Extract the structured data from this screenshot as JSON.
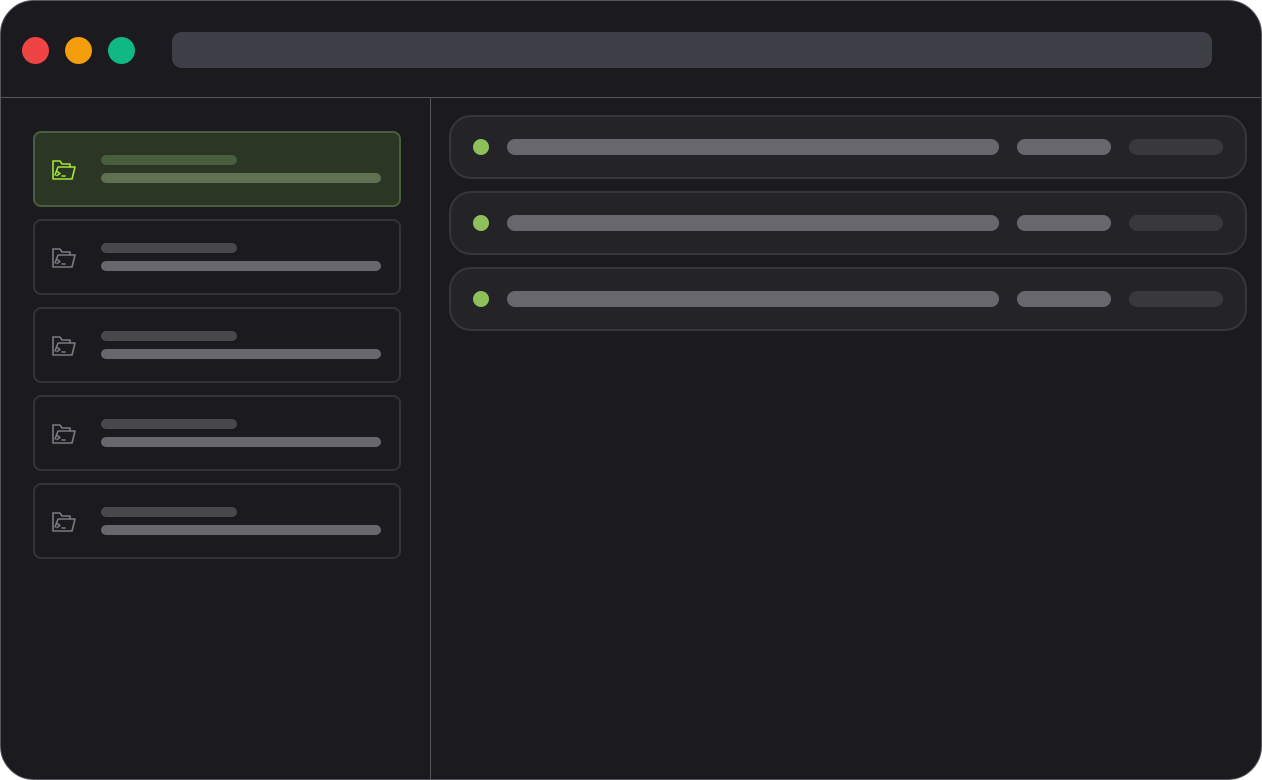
{
  "window": {
    "traffic_lights": [
      {
        "name": "close",
        "color": "#ef4444"
      },
      {
        "name": "minimize",
        "color": "#f59e0b"
      },
      {
        "name": "maximize",
        "color": "#10b981"
      }
    ],
    "address_bar": {
      "text": ""
    }
  },
  "sidebar": {
    "items": [
      {
        "icon": "folder-terminal-icon",
        "title": "",
        "subtitle": "",
        "active": true
      },
      {
        "icon": "folder-terminal-icon",
        "title": "",
        "subtitle": "",
        "active": false
      },
      {
        "icon": "folder-terminal-icon",
        "title": "",
        "subtitle": "",
        "active": false
      },
      {
        "icon": "folder-terminal-icon",
        "title": "",
        "subtitle": "",
        "active": false
      },
      {
        "icon": "folder-terminal-icon",
        "title": "",
        "subtitle": "",
        "active": false
      }
    ]
  },
  "main": {
    "rows": [
      {
        "status": "online",
        "label": "",
        "meta": "",
        "extra": ""
      },
      {
        "status": "online",
        "label": "",
        "meta": "",
        "extra": ""
      },
      {
        "status": "online",
        "label": "",
        "meta": "",
        "extra": ""
      }
    ]
  },
  "colors": {
    "background": "#1b1b1f",
    "border": "#55555b",
    "accent": "#a3e635",
    "status_online": "#8fbf5a",
    "active_card_bg": "#2b3625",
    "active_card_border": "#4a5d3e"
  }
}
